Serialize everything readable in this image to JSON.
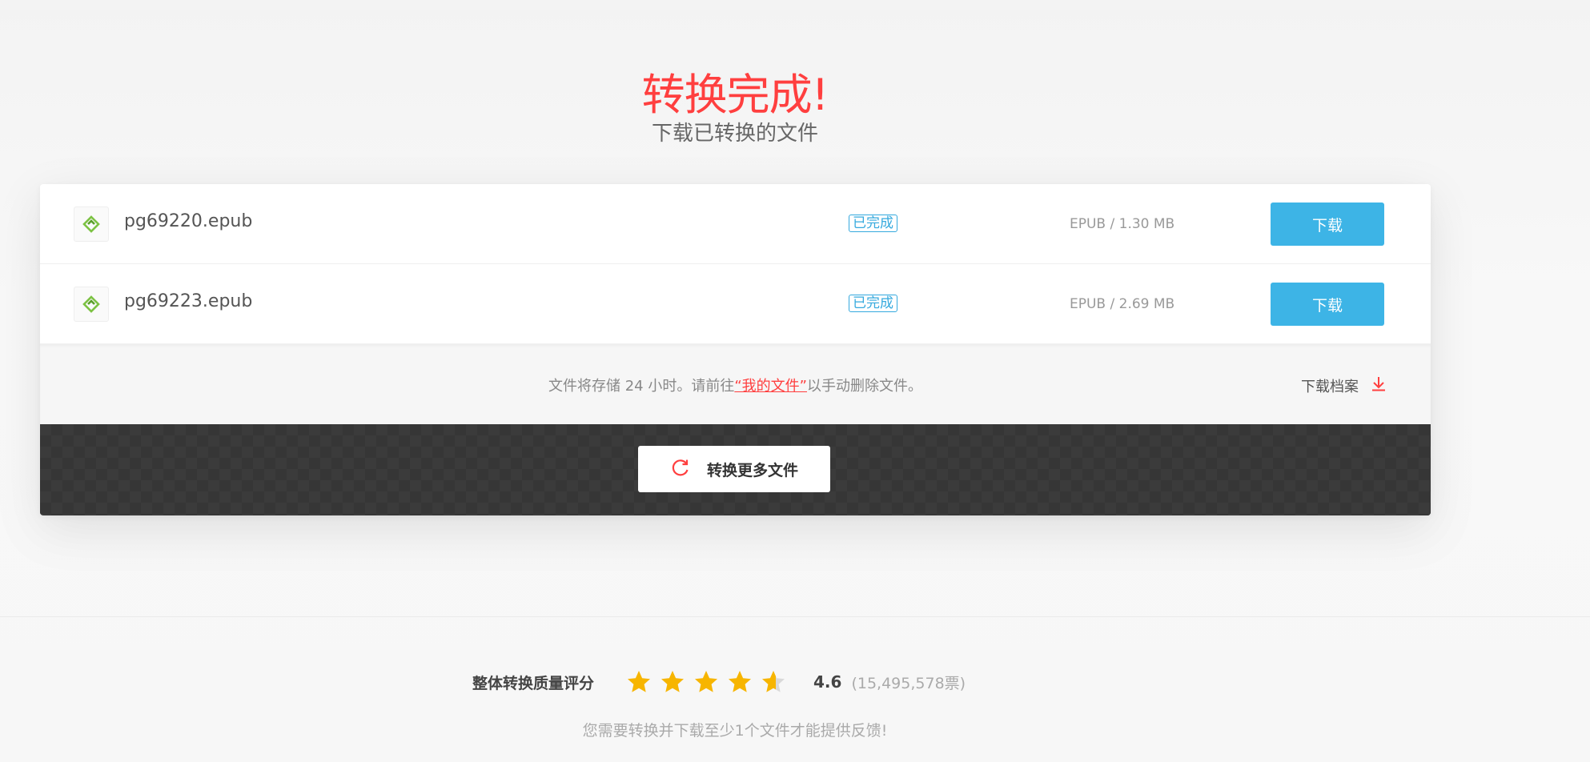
{
  "header": {
    "title": "转换完成!",
    "subtitle": "下载已转换的文件"
  },
  "files": [
    {
      "name": "pg69220.epub",
      "status": "已完成",
      "meta": "EPUB / 1.30 MB",
      "download_label": "下载"
    },
    {
      "name": "pg69223.epub",
      "status": "已完成",
      "meta": "EPUB / 2.69 MB",
      "download_label": "下载"
    }
  ],
  "info": {
    "text_before": "文件将存储 24 小时。请前往",
    "link_text": "“我的文件”",
    "text_after": "以手动删除文件。",
    "archive_label": "下载档案"
  },
  "actions": {
    "convert_more_label": "转换更多文件"
  },
  "rating": {
    "label": "整体转换质量评分",
    "score": "4.6",
    "score_value": 4.6,
    "max_stars": 5,
    "votes": "(15,495,578票)",
    "note": "您需要转换并下载至少1个文件才能提供反馈!"
  },
  "colors": {
    "accent_red": "#ff3f3f",
    "download_blue": "#3db4e6",
    "status_blue": "#35a9de",
    "star_gold": "#f7b500",
    "epub_green": "#7cc243"
  },
  "icons": {
    "file": "epub-icon",
    "archive": "download-arrow-icon",
    "refresh": "refresh-icon",
    "star": "star-icon"
  }
}
